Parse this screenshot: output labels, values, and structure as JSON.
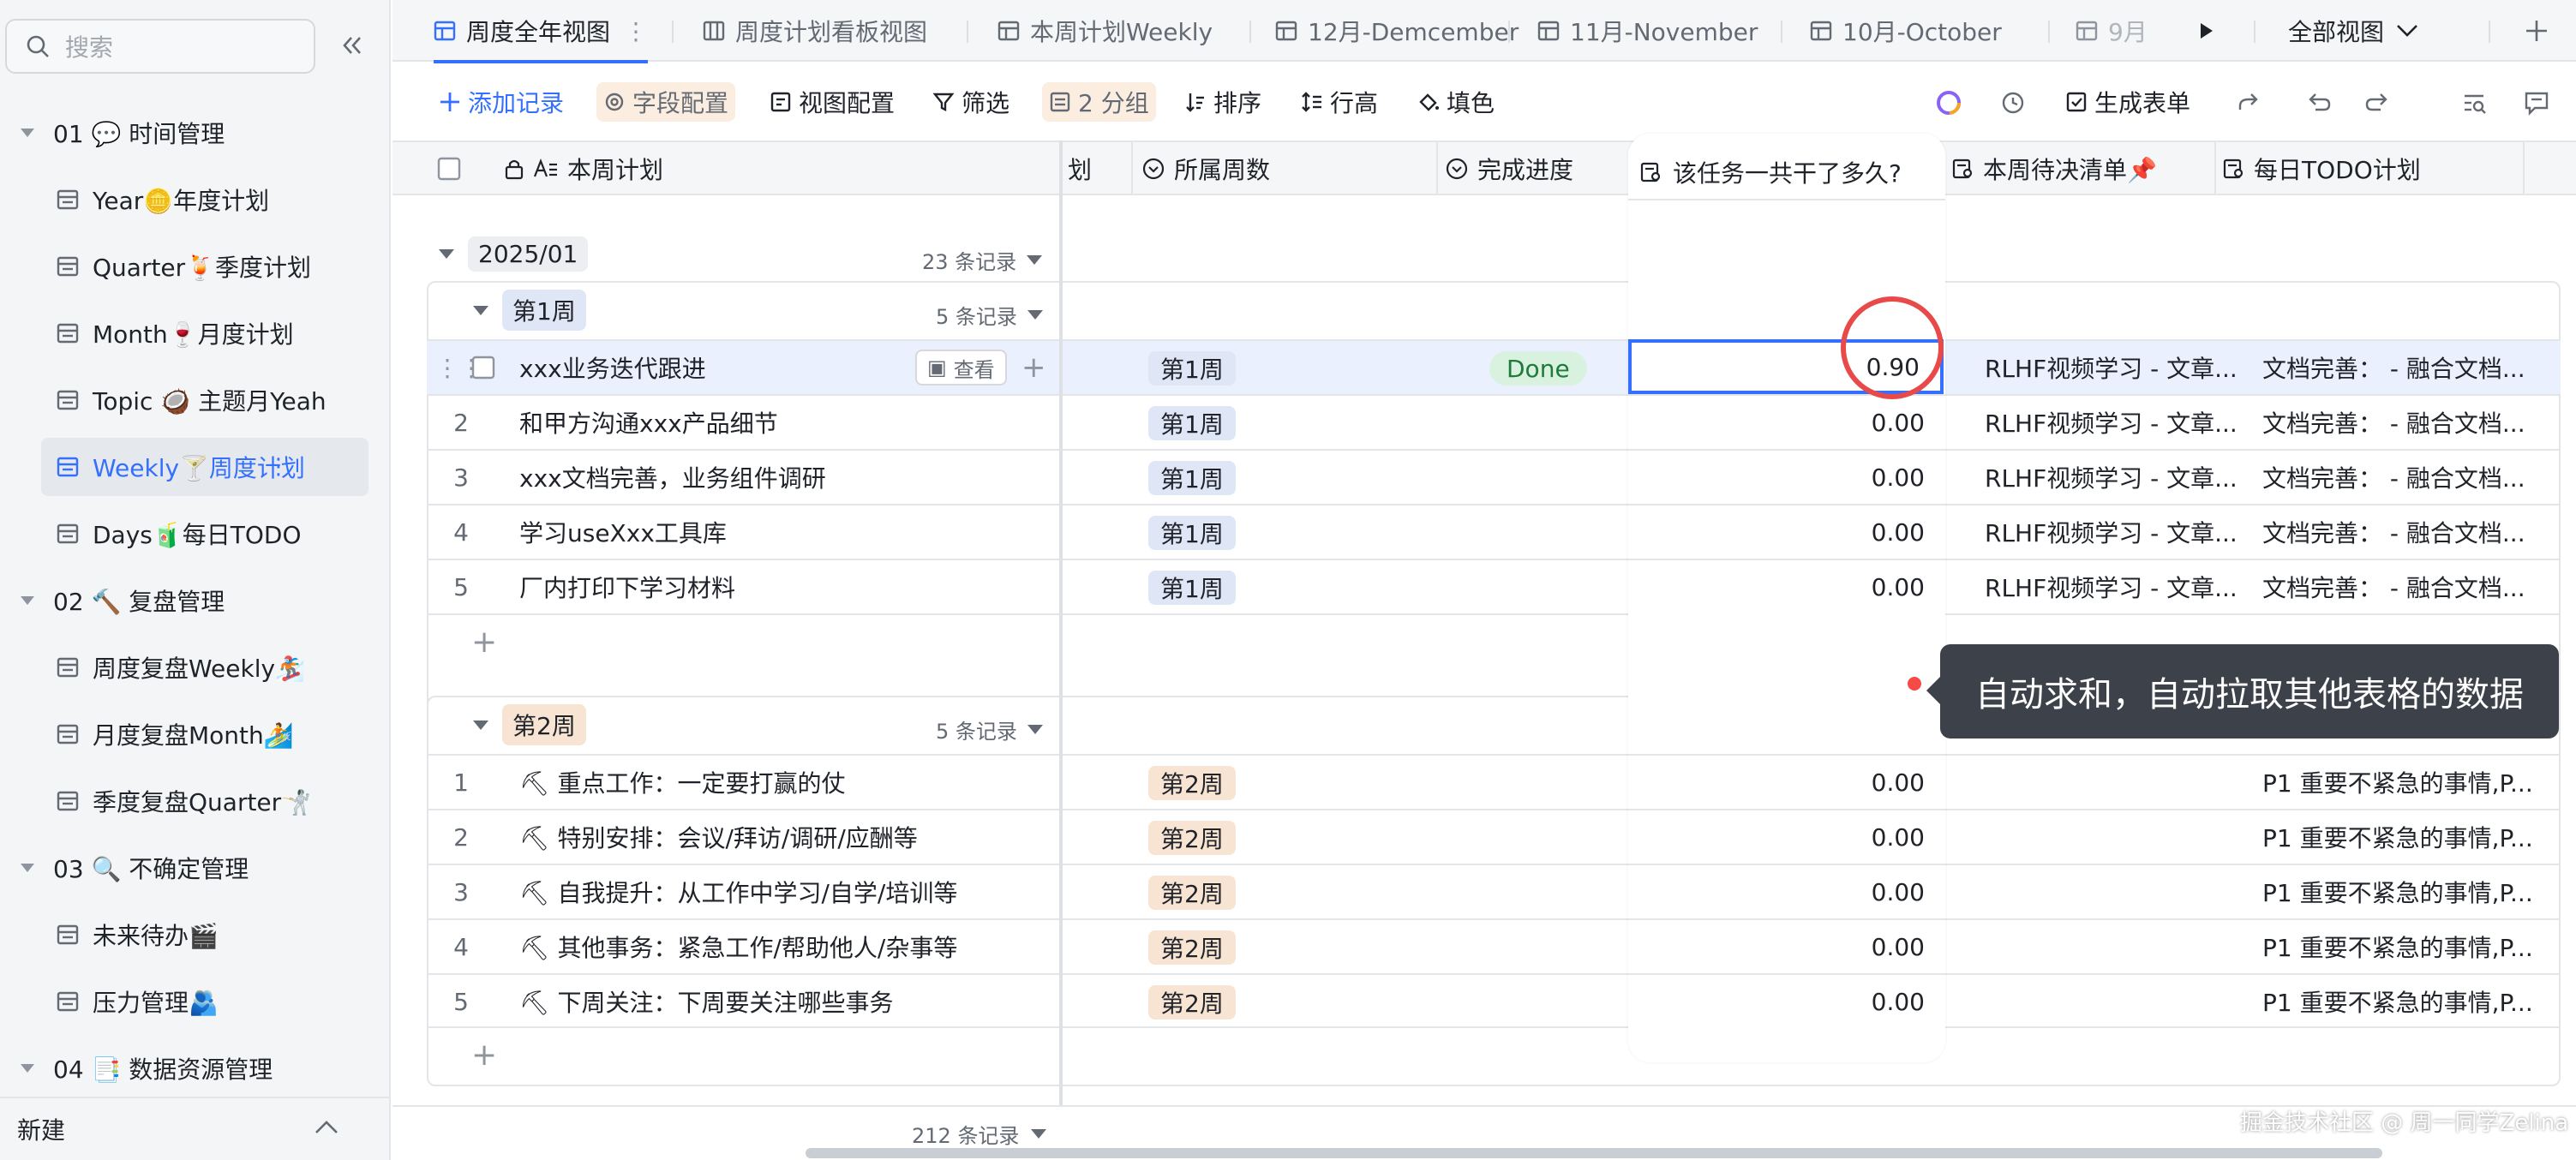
{
  "sidebar": {
    "search_placeholder": "搜索",
    "items": [
      {
        "label": "01 💬 时间管理",
        "level": 0
      },
      {
        "label": "Year🪙年度计划",
        "level": 1
      },
      {
        "label": "Quarter🍹季度计划",
        "level": 1
      },
      {
        "label": "Month🍷月度计划",
        "level": 1
      },
      {
        "label": "Topic 🥥 主题月Yeah",
        "level": 1
      },
      {
        "label": "Weekly🍸周度计划",
        "level": 1,
        "active": true
      },
      {
        "label": "Days🧃每日TODO",
        "level": 1
      },
      {
        "label": "02 🔨 复盘管理",
        "level": 0
      },
      {
        "label": "周度复盘Weekly🏂",
        "level": 1
      },
      {
        "label": "月度复盘Month🏄",
        "level": 1
      },
      {
        "label": "季度复盘Quarter🤺",
        "level": 1
      },
      {
        "label": "03 🔍 不确定管理",
        "level": 0
      },
      {
        "label": "未来待办🎬",
        "level": 1
      },
      {
        "label": "压力管理🫂",
        "level": 1
      },
      {
        "label": "04 📑 数据资源管理",
        "level": 0
      }
    ],
    "new_label": "新建"
  },
  "tabs": [
    {
      "label": "周度全年视图",
      "active": true
    },
    {
      "label": "周度计划看板视图"
    },
    {
      "label": "本周计划Weekly"
    },
    {
      "label": "12月-Demcember"
    },
    {
      "label": "11月-November"
    },
    {
      "label": "10月-October"
    },
    {
      "label": "9月"
    }
  ],
  "all_views_label": "全部视图",
  "toolbar": {
    "add_record": "添加记录",
    "field_config": "字段配置",
    "view_config": "视图配置",
    "filter": "筛选",
    "group": "2 分组",
    "sort": "排序",
    "row_height": "行高",
    "fill": "填色",
    "generate_form": "生成表单"
  },
  "columns": {
    "plan": "本周计划",
    "partial": "划",
    "week": "所属周数",
    "progress": "完成进度",
    "duration": "该任务一共干了多久?",
    "pending": "本周待决清单📌",
    "todo": "每日TODO计划"
  },
  "year_group": {
    "label": "2025/01",
    "count": "23 条记录"
  },
  "groups": [
    {
      "label": "第1周",
      "count": "5 条记录",
      "rows": [
        {
          "num": "",
          "title": "xxx业务迭代跟进",
          "week": "第1周",
          "progress": "Done",
          "duration": "0.90",
          "pending": "RLHF视频学习 - 文章...",
          "todo": "文档完善：  - 融合文档..."
        },
        {
          "num": "2",
          "title": "和甲方沟通xxx产品细节",
          "week": "第1周",
          "progress": "",
          "duration": "0.00",
          "pending": "RLHF视频学习 - 文章...",
          "todo": "文档完善：  - 融合文档..."
        },
        {
          "num": "3",
          "title": "xxx文档完善，业务组件调研",
          "week": "第1周",
          "progress": "",
          "duration": "0.00",
          "pending": "RLHF视频学习 - 文章...",
          "todo": "文档完善：  - 融合文档..."
        },
        {
          "num": "4",
          "title": "学习useXxx工具库",
          "week": "第1周",
          "progress": "",
          "duration": "0.00",
          "pending": "RLHF视频学习 - 文章...",
          "todo": "文档完善：  - 融合文档..."
        },
        {
          "num": "5",
          "title": "厂内打印下学习材料",
          "week": "第1周",
          "progress": "",
          "duration": "0.00",
          "pending": "RLHF视频学习 - 文章...",
          "todo": "文档完善：  - 融合文档..."
        }
      ]
    },
    {
      "label": "第2周",
      "count": "5 条记录",
      "rows": [
        {
          "num": "1",
          "title": "⛏ 重点工作：一定要打赢的仗",
          "week": "第2周",
          "duration": "0.00",
          "todo": "P1 重要不紧急的事情,P..."
        },
        {
          "num": "2",
          "title": "⛏ 特别安排：会议/拜访/调研/应酬等",
          "week": "第2周",
          "duration": "0.00",
          "todo": "P1 重要不紧急的事情,P..."
        },
        {
          "num": "3",
          "title": "⛏ 自我提升：从工作中学习/自学/培训等",
          "week": "第2周",
          "duration": "0.00",
          "todo": "P1 重要不紧急的事情,P..."
        },
        {
          "num": "4",
          "title": "⛏ 其他事务：紧急工作/帮助他人/杂事等",
          "week": "第2周",
          "duration": "0.00",
          "todo": "P1 重要不紧急的事情,P..."
        },
        {
          "num": "5",
          "title": "⛏ 下周关注：下周要关注哪些事务",
          "week": "第2周",
          "duration": "0.00",
          "todo": "P1 重要不紧急的事情,P..."
        }
      ]
    }
  ],
  "view_button": "查看",
  "footer_count": "212 条记录",
  "tooltip": "自动求和，自动拉取其他表格的数据",
  "watermark": "掘金技术社区 @ 周一同学Zelina",
  "colors": {
    "accent": "#3370ff",
    "highlight_circle": "#e84a4a",
    "tooltip_bg": "#3d4149"
  }
}
